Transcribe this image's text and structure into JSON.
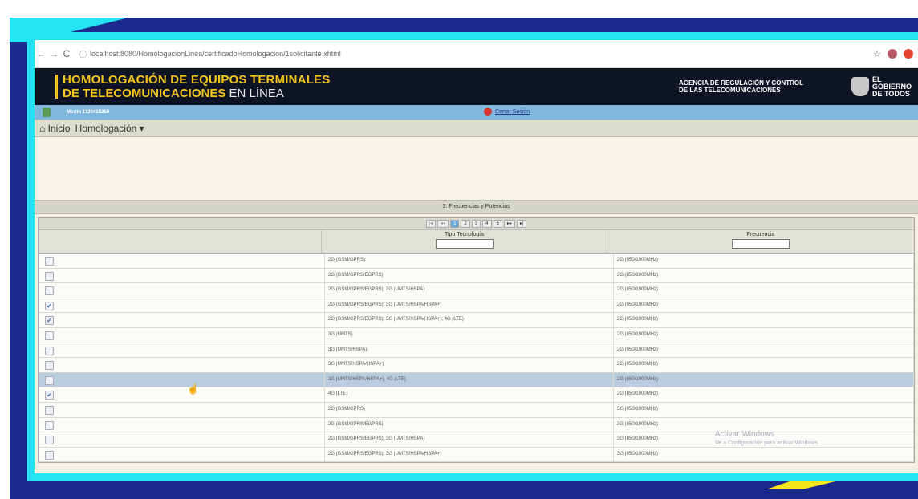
{
  "browser": {
    "back": "←",
    "forward": "→",
    "reload": "C",
    "info_icon": "ⓘ",
    "url": "localhost:8080/HomologacionLinea/certificadoHomologacion/1solicitante.xhtml",
    "star": "☆"
  },
  "header": {
    "title_line1": "HOMOLOGACIÓN DE EQUIPOS TERMINALES",
    "title_line2_bold": "DE TELECOMUNICACIONES",
    "title_line2_light": "EN LÍNEA",
    "agency_line1": "AGENCIA DE REGULACIÓN Y CONTROL",
    "agency_line2": "DE LAS TELECOMUNICACIONES",
    "gov_line1": "EL",
    "gov_line2": "GOBIERNO",
    "gov_line3": "DE TODOS"
  },
  "user_bar": {
    "user": "Martín 1720415259",
    "logout": "Cerrar Sesión"
  },
  "menu": {
    "home": "⌂ Inicio",
    "homologacion": "Homologación ▾"
  },
  "section": {
    "title": "3. Frecuencias y Potencias"
  },
  "pager": {
    "first": "|◂",
    "prev": "◂◂",
    "pages": [
      "1",
      "2",
      "3",
      "4",
      "5"
    ],
    "next": "▸▸",
    "last": "▸|"
  },
  "table": {
    "headers": {
      "col1": "",
      "col2": "Tipo Tecnología",
      "col3": "Frecuencia"
    },
    "rows": [
      {
        "checked": false,
        "tipo": "2G (GSM/GPRS)",
        "frecuencia": "2G (850/1900MHz)",
        "highlight": false
      },
      {
        "checked": false,
        "tipo": "2G (GSM/GPRS/EGPRS)",
        "frecuencia": "2G (850/1900MHz)",
        "highlight": false
      },
      {
        "checked": false,
        "tipo": "2G (GSM/GPRS/EGPRS); 3G (UMTS/HSPA)",
        "frecuencia": "2G (850/1900MHz)",
        "highlight": false
      },
      {
        "checked": true,
        "tipo": "2G (GSM/GPRS/EGPRS); 3G (UMTS/HSPA/HSPA+)",
        "frecuencia": "2G (850/1900MHz)",
        "highlight": false
      },
      {
        "checked": true,
        "tipo": "2G (GSM/GPRS/EGPRS); 3G (UMTS/HSPA/HSPA+); 4G (LTE)",
        "frecuencia": "2G (850/1900MHz)",
        "highlight": false
      },
      {
        "checked": false,
        "tipo": "3G (UMTS)",
        "frecuencia": "2G (850/1900MHz)",
        "highlight": false
      },
      {
        "checked": false,
        "tipo": "3G (UMTS/HSPA)",
        "frecuencia": "2G (850/1900MHz)",
        "highlight": false
      },
      {
        "checked": false,
        "tipo": "3G (UMTS/HSPA/HSPA+)",
        "frecuencia": "2G (850/1900MHz)",
        "highlight": false
      },
      {
        "checked": false,
        "tipo": "3G (UMTS/HSPA/HSPA+); 4G (LTE)",
        "frecuencia": "2G (850/1900MHz)",
        "highlight": true
      },
      {
        "checked": true,
        "tipo": "4G (LTE)",
        "frecuencia": "2G (850/1900MHz)",
        "highlight": false
      },
      {
        "checked": false,
        "tipo": "2G (GSM/GPRS)",
        "frecuencia": "3G (850/1900MHz)",
        "highlight": false
      },
      {
        "checked": false,
        "tipo": "2G (GSM/GPRS/EGPRS)",
        "frecuencia": "3G (850/1900MHz)",
        "highlight": false
      },
      {
        "checked": false,
        "tipo": "2G (GSM/GPRS/EGPRS); 3G (UMTS/HSPA)",
        "frecuencia": "3G (850/1900MHz)",
        "highlight": false
      },
      {
        "checked": false,
        "tipo": "2G (GSM/GPRS/EGPRS); 3G (UMTS/HSPA/HSPA+)",
        "frecuencia": "3G (850/1900MHz)",
        "highlight": false
      }
    ]
  },
  "watermark": {
    "line1": "Activar Windows",
    "line2": "Ve a Configuración para activar Windows."
  },
  "colors": {
    "frame_blue": "#1b2a8c",
    "frame_cyan": "#22e4f2",
    "accent_yellow": "#f5e61b",
    "header_yellow": "#f5c51b"
  }
}
